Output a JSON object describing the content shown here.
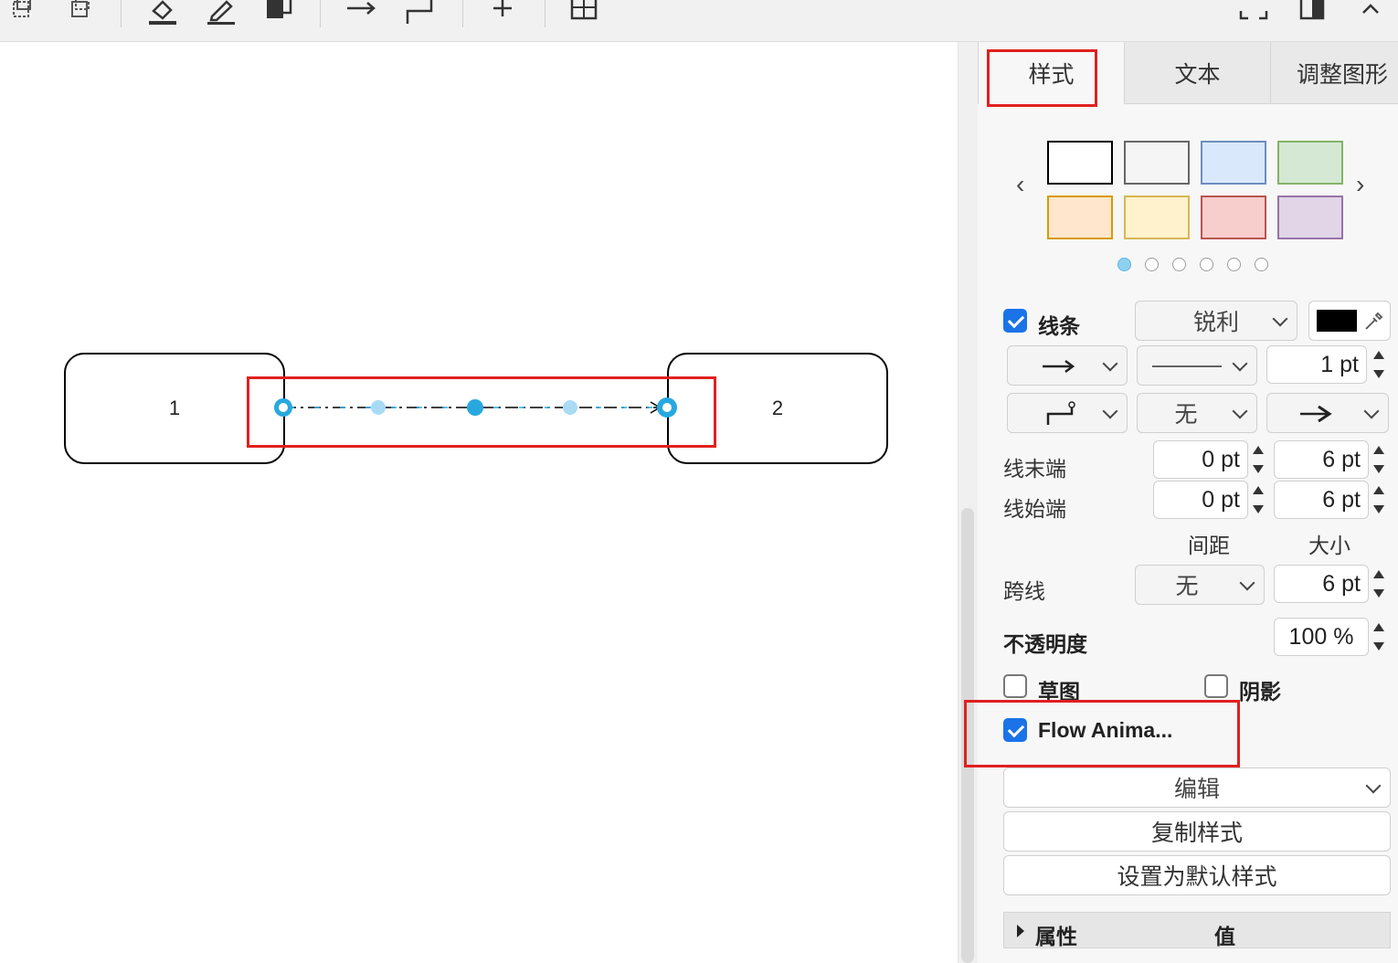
{
  "toolbar": {
    "icons": [
      "to-front-icon",
      "to-back-icon",
      "fill-color-icon",
      "line-color-icon",
      "shadow-icon",
      "connection-arrow-icon",
      "waypoints-icon",
      "insert-plus-icon",
      "table-icon",
      "fullscreen-icon",
      "format-panel-toggle-icon",
      "collapse-icon"
    ]
  },
  "canvas": {
    "shape1": {
      "label": "1"
    },
    "shape2": {
      "label": "2"
    },
    "edge": {
      "style": "dash-dot",
      "animated": true,
      "color": "#000000",
      "handle_color": "#29a8e0"
    },
    "highlight_color": "#e0201f"
  },
  "panel": {
    "tabs": [
      {
        "label": "样式",
        "active": true
      },
      {
        "label": "文本",
        "active": false
      },
      {
        "label": "调整图形",
        "active": false
      }
    ],
    "swatches": [
      {
        "fill": "#ffffff",
        "stroke": "#000000"
      },
      {
        "fill": "#f5f5f5",
        "stroke": "#666666"
      },
      {
        "fill": "#dae8fc",
        "stroke": "#6c8ebf"
      },
      {
        "fill": "#d5e8d4",
        "stroke": "#82b366"
      },
      {
        "fill": "#ffe6cc",
        "stroke": "#d79b00"
      },
      {
        "fill": "#fff2cc",
        "stroke": "#d6b656"
      },
      {
        "fill": "#f8cecc",
        "stroke": "#b85450"
      },
      {
        "fill": "#e1d5e7",
        "stroke": "#9673a6"
      }
    ],
    "swatch_pages": 6,
    "swatch_page_active": 1,
    "line": {
      "enabled": true,
      "label": "线条",
      "style_value": "锐利",
      "color": "#000000",
      "pattern": "solid",
      "width": "1 pt",
      "waypoint": "orthogonal",
      "start_arrow": "无",
      "end_arrow": "arrow"
    },
    "line_end": {
      "label": "线末端",
      "spacing": "0 pt",
      "size": "6 pt"
    },
    "line_start": {
      "label": "线始端",
      "spacing": "0 pt",
      "size": "6 pt"
    },
    "col_spacing": "间距",
    "col_size": "大小",
    "jump": {
      "label": "跨线",
      "style": "无",
      "size": "6 pt"
    },
    "opacity": {
      "label": "不透明度",
      "value": "100 %"
    },
    "sketch": {
      "label": "草图",
      "checked": false
    },
    "shadow": {
      "label": "阴影",
      "checked": false
    },
    "flow_animation": {
      "label": "Flow Anima...",
      "checked": true
    },
    "edit_label": "编辑",
    "copy_style_label": "复制样式",
    "set_default_label": "设置为默认样式",
    "props": {
      "col1": "属性",
      "col2": "值"
    }
  }
}
